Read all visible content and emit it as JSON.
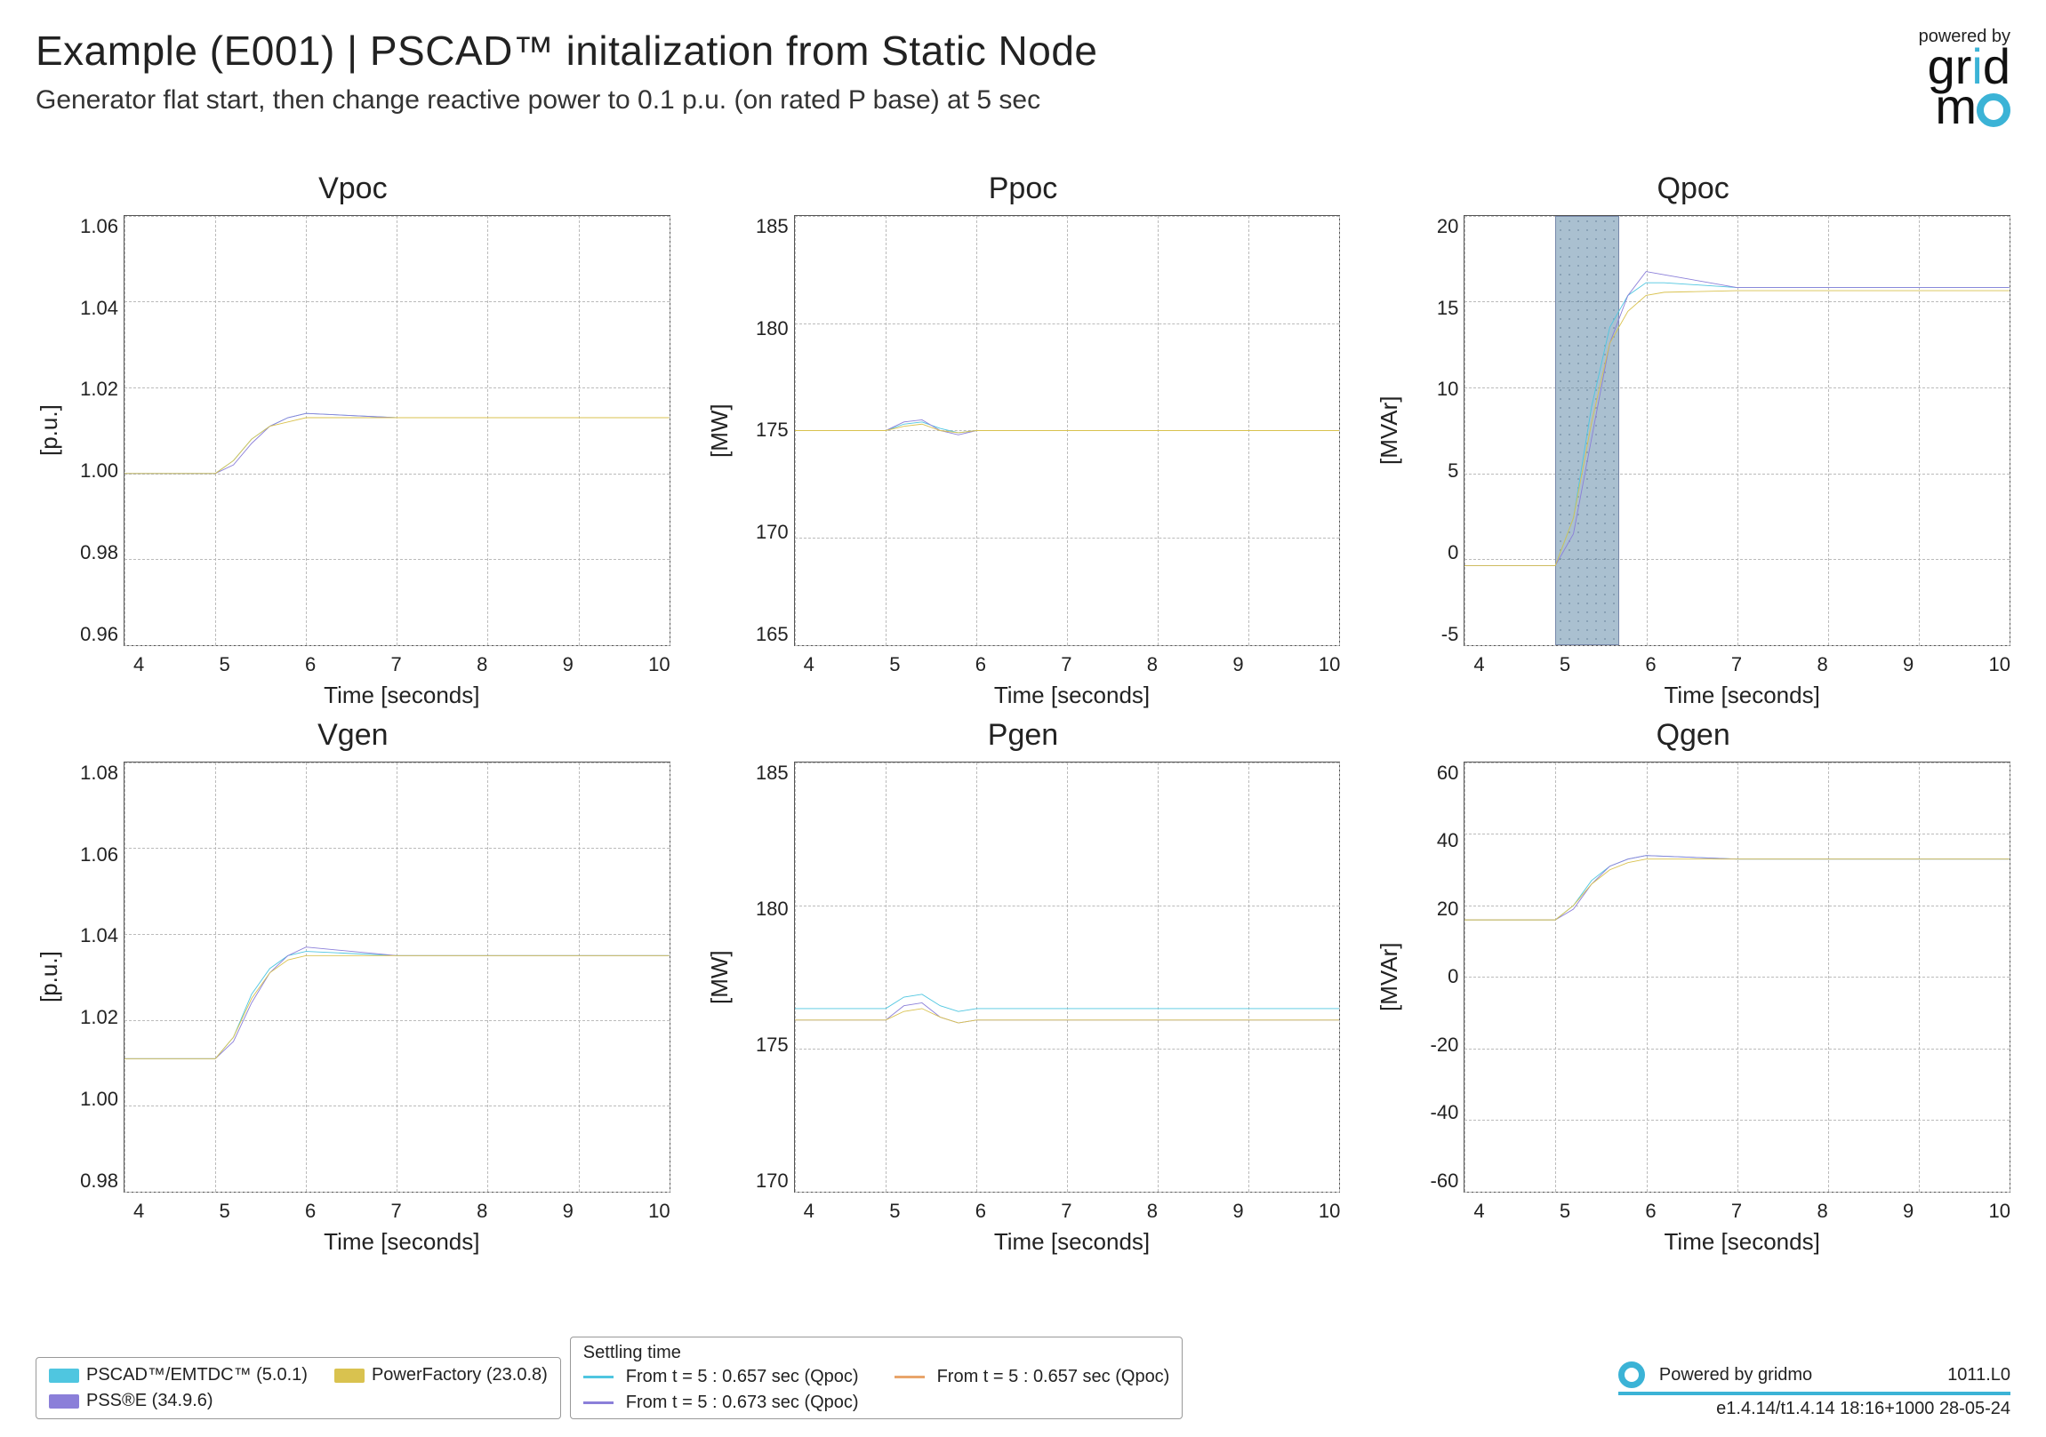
{
  "header": {
    "title": "Example (E001) | PSCAD™ initalization from Static Node",
    "subtitle": "Generator flat start, then change reactive power to 0.1 p.u. (on rated P base) at 5 sec",
    "powered_by": "powered by",
    "logo_text_1": "gr",
    "logo_text_2": "d",
    "logo_text_3": "m"
  },
  "xlabel": "Time [seconds]",
  "xticks": [
    "4",
    "5",
    "6",
    "7",
    "8",
    "9",
    "10"
  ],
  "series_colors": {
    "pscad": "#4fc6e0",
    "psse": "#8b7fd9",
    "powerfactory": "#d9c24f"
  },
  "legend": {
    "pscad": "PSCAD™/EMTDC™ (5.0.1)",
    "psse": "PSS®E (34.9.6)",
    "powerfactory": "PowerFactory (23.0.8)"
  },
  "settling": {
    "title": "Settling time",
    "items": [
      {
        "color": "#4fc6e0",
        "text": "From t = 5 : 0.657 sec (Qpoc)"
      },
      {
        "color": "#8b7fd9",
        "text": "From t = 5 : 0.673 sec (Qpoc)"
      },
      {
        "color": "#e8a56b",
        "text": "From t = 5 : 0.657 sec (Qpoc)"
      }
    ]
  },
  "footer": {
    "powered": "Powered by gridmo",
    "code": "1011.L0",
    "version": "e1.4.14/t1.4.14 18:16+1000 28-05-24"
  },
  "charts": [
    {
      "id": "vpoc",
      "title": "Vpoc",
      "ylabel": "[p.u.]",
      "yticks": [
        "1.06",
        "1.04",
        "1.02",
        "1.00",
        "0.98",
        "0.96"
      ]
    },
    {
      "id": "ppoc",
      "title": "Ppoc",
      "ylabel": "[MW]",
      "yticks": [
        "185",
        "180",
        "175",
        "170",
        "165"
      ]
    },
    {
      "id": "qpoc",
      "title": "Qpoc",
      "ylabel": "[MVAr]",
      "yticks": [
        "20",
        "15",
        "10",
        "5",
        "0",
        "-5"
      ],
      "shade": [
        5.0,
        5.7
      ]
    },
    {
      "id": "vgen",
      "title": "Vgen",
      "ylabel": "[p.u.]",
      "yticks": [
        "1.08",
        "1.06",
        "1.04",
        "1.02",
        "1.00",
        "0.98"
      ]
    },
    {
      "id": "pgen",
      "title": "Pgen",
      "ylabel": "[MW]",
      "yticks": [
        "185",
        "180",
        "175",
        "170"
      ]
    },
    {
      "id": "qgen",
      "title": "Qgen",
      "ylabel": "[MVAr]",
      "yticks": [
        "60",
        "40",
        "20",
        "0",
        "-20",
        "-40",
        "-60"
      ]
    }
  ],
  "chart_data": [
    {
      "id": "vpoc",
      "type": "line",
      "title": "Vpoc",
      "xlabel": "Time [seconds]",
      "ylabel": "[p.u.]",
      "x": [
        4,
        5,
        5.2,
        5.4,
        5.6,
        5.8,
        6,
        7,
        8,
        9,
        10
      ],
      "xlim": [
        4,
        10
      ],
      "ylim": [
        0.96,
        1.06
      ],
      "series": [
        {
          "name": "PSCAD™/EMTDC™ (5.0.1)",
          "values": [
            1.0,
            1.0,
            1.003,
            1.008,
            1.011,
            1.013,
            1.014,
            1.013,
            1.013,
            1.013,
            1.013
          ]
        },
        {
          "name": "PSS®E (34.9.6)",
          "values": [
            1.0,
            1.0,
            1.002,
            1.007,
            1.011,
            1.013,
            1.014,
            1.013,
            1.013,
            1.013,
            1.013
          ]
        },
        {
          "name": "PowerFactory (23.0.8)",
          "values": [
            1.0,
            1.0,
            1.003,
            1.008,
            1.011,
            1.012,
            1.013,
            1.013,
            1.013,
            1.013,
            1.013
          ]
        }
      ]
    },
    {
      "id": "ppoc",
      "type": "line",
      "title": "Ppoc",
      "xlabel": "Time [seconds]",
      "ylabel": "[MW]",
      "x": [
        4,
        5,
        5.2,
        5.4,
        5.6,
        5.8,
        6,
        7,
        8,
        9,
        10
      ],
      "xlim": [
        4,
        10
      ],
      "ylim": [
        165,
        185
      ],
      "series": [
        {
          "name": "PSCAD™/EMTDC™ (5.0.1)",
          "values": [
            175.0,
            175.0,
            175.3,
            175.4,
            175.1,
            174.9,
            175.0,
            175.0,
            175.0,
            175.0,
            175.0
          ]
        },
        {
          "name": "PSS®E (34.9.6)",
          "values": [
            175.0,
            175.0,
            175.4,
            175.5,
            175.0,
            174.8,
            175.0,
            175.0,
            175.0,
            175.0,
            175.0
          ]
        },
        {
          "name": "PowerFactory (23.0.8)",
          "values": [
            175.0,
            175.0,
            175.2,
            175.3,
            175.0,
            174.9,
            175.0,
            175.0,
            175.0,
            175.0,
            175.0
          ]
        }
      ]
    },
    {
      "id": "qpoc",
      "type": "line",
      "title": "Qpoc",
      "xlabel": "Time [seconds]",
      "ylabel": "[MVAr]",
      "x": [
        4,
        5,
        5.2,
        5.4,
        5.6,
        5.8,
        6,
        6.2,
        7,
        8,
        9,
        10
      ],
      "xlim": [
        4,
        10
      ],
      "ylim": [
        -5,
        22
      ],
      "shaded_region": [
        5.0,
        5.7
      ],
      "series": [
        {
          "name": "PSCAD™/EMTDC™ (5.0.1)",
          "values": [
            0,
            0,
            3,
            10,
            15,
            17,
            17.8,
            17.8,
            17.5,
            17.5,
            17.5,
            17.5
          ]
        },
        {
          "name": "PSS®E (34.9.6)",
          "values": [
            0,
            0,
            2,
            8,
            14,
            17,
            18.5,
            18.3,
            17.5,
            17.5,
            17.5,
            17.5
          ]
        },
        {
          "name": "PowerFactory (23.0.8)",
          "values": [
            0,
            0,
            3,
            9,
            14,
            16,
            17.0,
            17.2,
            17.3,
            17.3,
            17.3,
            17.3
          ]
        }
      ]
    },
    {
      "id": "vgen",
      "type": "line",
      "title": "Vgen",
      "xlabel": "Time [seconds]",
      "ylabel": "[p.u.]",
      "x": [
        4,
        5,
        5.2,
        5.4,
        5.6,
        5.8,
        6,
        7,
        8,
        9,
        10
      ],
      "xlim": [
        4,
        10
      ],
      "ylim": [
        0.98,
        1.08
      ],
      "series": [
        {
          "name": "PSCAD™/EMTDC™ (5.0.1)",
          "values": [
            1.011,
            1.011,
            1.016,
            1.026,
            1.032,
            1.035,
            1.036,
            1.035,
            1.035,
            1.035,
            1.035
          ]
        },
        {
          "name": "PSS®E (34.9.6)",
          "values": [
            1.011,
            1.011,
            1.015,
            1.024,
            1.031,
            1.035,
            1.037,
            1.035,
            1.035,
            1.035,
            1.035
          ]
        },
        {
          "name": "PowerFactory (23.0.8)",
          "values": [
            1.011,
            1.011,
            1.016,
            1.025,
            1.031,
            1.034,
            1.035,
            1.035,
            1.035,
            1.035,
            1.035
          ]
        }
      ]
    },
    {
      "id": "pgen",
      "type": "line",
      "title": "Pgen",
      "xlabel": "Time [seconds]",
      "ylabel": "[MW]",
      "x": [
        4,
        5,
        5.2,
        5.4,
        5.6,
        5.8,
        6,
        7,
        8,
        9,
        10
      ],
      "xlim": [
        4,
        10
      ],
      "ylim": [
        170,
        185
      ],
      "series": [
        {
          "name": "PSCAD™/EMTDC™ (5.0.1)",
          "values": [
            176.4,
            176.4,
            176.8,
            176.9,
            176.5,
            176.3,
            176.4,
            176.4,
            176.4,
            176.4,
            176.4
          ]
        },
        {
          "name": "PSS®E (34.9.6)",
          "values": [
            176.0,
            176.0,
            176.5,
            176.6,
            176.1,
            175.9,
            176.0,
            176.0,
            176.0,
            176.0,
            176.0
          ]
        },
        {
          "name": "PowerFactory (23.0.8)",
          "values": [
            176.0,
            176.0,
            176.3,
            176.4,
            176.1,
            175.9,
            176.0,
            176.0,
            176.0,
            176.0,
            176.0
          ]
        }
      ]
    },
    {
      "id": "qgen",
      "type": "line",
      "title": "Qgen",
      "xlabel": "Time [seconds]",
      "ylabel": "[MVAr]",
      "x": [
        4,
        5,
        5.2,
        5.4,
        5.6,
        5.8,
        6,
        7,
        8,
        9,
        10
      ],
      "xlim": [
        4,
        10
      ],
      "ylim": [
        -60,
        60
      ],
      "series": [
        {
          "name": "PSCAD™/EMTDC™ (5.0.1)",
          "values": [
            16,
            16,
            20,
            27,
            31,
            33,
            34,
            33,
            33,
            33,
            33
          ]
        },
        {
          "name": "PSS®E (34.9.6)",
          "values": [
            16,
            16,
            19,
            26,
            31,
            33,
            34,
            33,
            33,
            33,
            33
          ]
        },
        {
          "name": "PowerFactory (23.0.8)",
          "values": [
            16,
            16,
            20,
            26,
            30,
            32,
            33,
            33,
            33,
            33,
            33
          ]
        }
      ]
    }
  ]
}
